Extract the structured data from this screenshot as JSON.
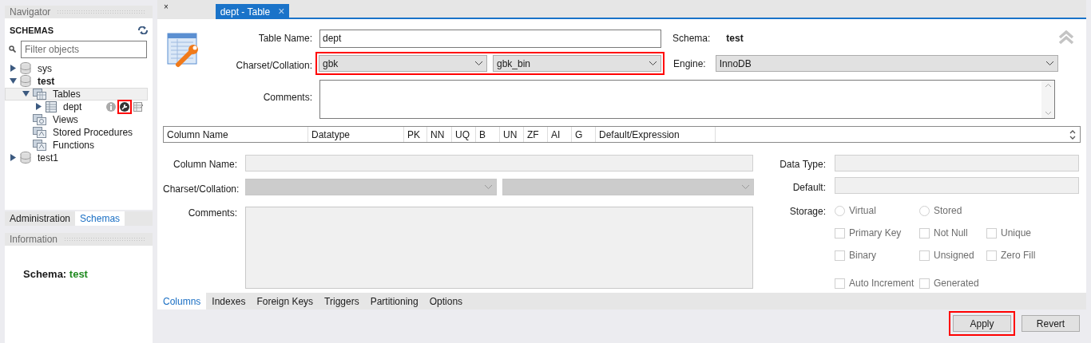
{
  "navigator": {
    "title": "Navigator",
    "section": "SCHEMAS",
    "filter": {
      "placeholder": "Filter objects"
    },
    "tree": [
      {
        "kind": "schema",
        "label": "sys",
        "expanded": false,
        "active": false,
        "selected": false
      },
      {
        "kind": "schema",
        "label": "test",
        "expanded": true,
        "active": true,
        "selected": false,
        "children": [
          {
            "kind": "tables",
            "label": "Tables",
            "expanded": true,
            "selected": true,
            "children": [
              {
                "kind": "table",
                "label": "dept",
                "expanded": false,
                "selected": false,
                "hovered": true,
                "tool_highlighted": true
              }
            ]
          },
          {
            "kind": "views",
            "label": "Views",
            "selected": false
          },
          {
            "kind": "routines",
            "label": "Stored Procedures",
            "selected": false
          },
          {
            "kind": "routines",
            "label": "Functions",
            "selected": false
          }
        ]
      },
      {
        "kind": "schema",
        "label": "test1",
        "expanded": false,
        "active": false,
        "selected": false
      }
    ],
    "tabs": [
      {
        "label": "Administration",
        "selected": false
      },
      {
        "label": "Schemas",
        "selected": true
      }
    ]
  },
  "information": {
    "title": "Information",
    "label": "Schema:",
    "value": "test"
  },
  "editor_tabs": [
    {
      "close": "×",
      "selected": false
    },
    {
      "label": "dept - Table",
      "close": "×",
      "selected": true
    }
  ],
  "table_form": {
    "table_name_label": "Table Name:",
    "table_name": "dept",
    "charset_label": "Charset/Collation:",
    "charset": "gbk",
    "collation": "gbk_bin",
    "charset_highlighted": true,
    "schema_label": "Schema:",
    "schema": "test",
    "engine_label": "Engine:",
    "engine": "InnoDB",
    "comments_label": "Comments:"
  },
  "columns_grid": {
    "columns": [
      "Column Name",
      "Datatype",
      "PK",
      "NN",
      "UQ",
      "B",
      "UN",
      "ZF",
      "AI",
      "G",
      "Default/Expression"
    ]
  },
  "column_form": {
    "column_name_label": "Column Name:",
    "charset_label": "Charset/Collation:",
    "comments_label": "Comments:",
    "data_type_label": "Data Type:",
    "default_label": "Default:",
    "storage_label": "Storage:",
    "storage": [
      {
        "label": "Virtual",
        "selected": false
      },
      {
        "label": "Stored",
        "selected": false
      }
    ],
    "flags": [
      {
        "label": "Primary Key",
        "checked": false
      },
      {
        "label": "Not Null",
        "checked": false
      },
      {
        "label": "Unique",
        "checked": false
      },
      {
        "label": "Binary",
        "checked": false
      },
      {
        "label": "Unsigned",
        "checked": false
      },
      {
        "label": "Zero Fill",
        "checked": false
      },
      {
        "label": "Auto Increment",
        "checked": false
      },
      {
        "label": "Generated",
        "checked": false
      }
    ]
  },
  "bottom_tabs": [
    {
      "label": "Columns",
      "selected": true
    },
    {
      "label": "Indexes",
      "selected": false
    },
    {
      "label": "Foreign Keys",
      "selected": false
    },
    {
      "label": "Triggers",
      "selected": false
    },
    {
      "label": "Partitioning",
      "selected": false
    },
    {
      "label": "Options",
      "selected": false
    }
  ],
  "buttons": [
    {
      "label": "Apply",
      "highlighted": true
    },
    {
      "label": "Revert",
      "highlighted": false
    }
  ]
}
